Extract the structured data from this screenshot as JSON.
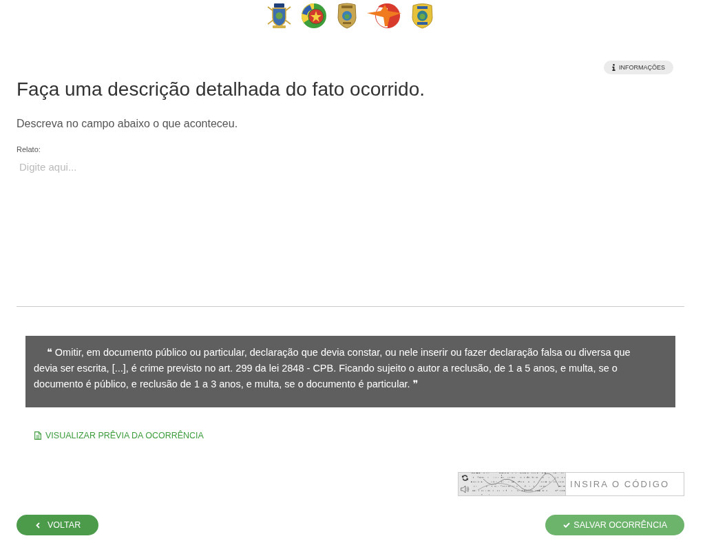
{
  "info_button": {
    "label": "INFORMAÇÕES"
  },
  "title": "Faça uma descrição detalhada do fato ocorrido.",
  "subtitle": "Descreva no campo abaixo o que aconteceu.",
  "report_field": {
    "label": "Relato:",
    "placeholder": "Digite aqui..."
  },
  "legal_notice": "❝ Omitir, em documento público ou particular, declaração que devia constar, ou nele inserir ou fazer declaração falsa ou diversa que devia ser escrita, [...], é crime previsto no art. 299 da lei 2848 - CPB. Ficando sujeito o autor a reclusão, de 1 a 5 anos, e multa, se o documento é público, e reclusão de 1 a 3 anos, e multa, se o documento é particular. ❞",
  "preview_link": "VISUALIZAR PRÊVIA DA OCORRÊNCIA",
  "captcha": {
    "placeholder": "INSIRA O CÓDIGO"
  },
  "buttons": [
    {
      "kind": "back",
      "label": "VOLTAR"
    },
    {
      "kind": "save",
      "label": "SALVAR OCORRÊNCIA"
    }
  ]
}
